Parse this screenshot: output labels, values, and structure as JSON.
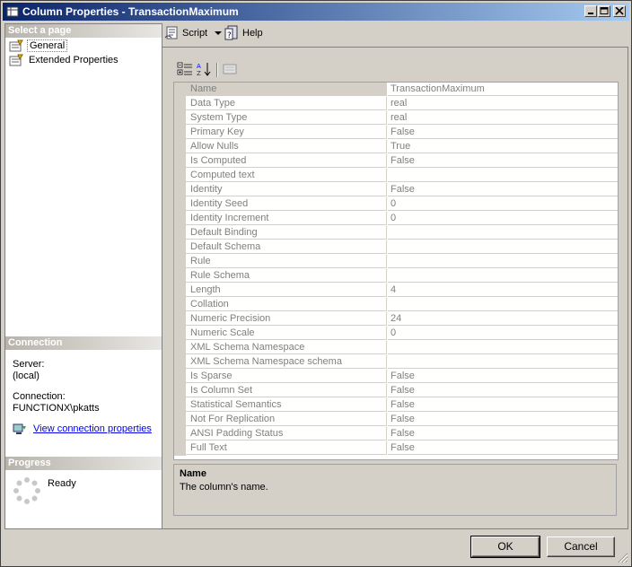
{
  "window": {
    "title": "Column Properties - TransactionMaximum"
  },
  "left_pane": {
    "select_page_header": "Select a page",
    "pages": [
      {
        "label": "General",
        "selected": true
      },
      {
        "label": "Extended Properties",
        "selected": false
      }
    ],
    "connection_header": "Connection",
    "server_label": "Server:",
    "server_value": "(local)",
    "connection_label": "Connection:",
    "connection_value": "FUNCTIONX\\pkatts",
    "view_connection_link": "View connection properties",
    "progress_header": "Progress",
    "progress_status": "Ready"
  },
  "toolbar": {
    "script_label": "Script",
    "help_label": "Help"
  },
  "properties": [
    {
      "name": "Name",
      "value": "TransactionMaximum"
    },
    {
      "name": "Data Type",
      "value": "real"
    },
    {
      "name": "System Type",
      "value": "real"
    },
    {
      "name": "Primary Key",
      "value": "False"
    },
    {
      "name": "Allow Nulls",
      "value": "True"
    },
    {
      "name": "Is Computed",
      "value": "False"
    },
    {
      "name": "Computed text",
      "value": ""
    },
    {
      "name": "Identity",
      "value": "False"
    },
    {
      "name": "Identity Seed",
      "value": "0"
    },
    {
      "name": "Identity Increment",
      "value": "0"
    },
    {
      "name": "Default Binding",
      "value": ""
    },
    {
      "name": "Default Schema",
      "value": ""
    },
    {
      "name": "Rule",
      "value": ""
    },
    {
      "name": "Rule Schema",
      "value": ""
    },
    {
      "name": "Length",
      "value": "4"
    },
    {
      "name": "Collation",
      "value": ""
    },
    {
      "name": "Numeric Precision",
      "value": "24"
    },
    {
      "name": "Numeric Scale",
      "value": "0"
    },
    {
      "name": "XML Schema Namespace",
      "value": ""
    },
    {
      "name": "XML Schema Namespace schema",
      "value": ""
    },
    {
      "name": "Is Sparse",
      "value": "False"
    },
    {
      "name": "Is Column Set",
      "value": "False"
    },
    {
      "name": "Statistical Semantics",
      "value": "False"
    },
    {
      "name": "Not For Replication",
      "value": "False"
    },
    {
      "name": "ANSI Padding Status",
      "value": "False"
    },
    {
      "name": "Full Text",
      "value": "False"
    }
  ],
  "description": {
    "title": "Name",
    "text": "The column's name."
  },
  "buttons": {
    "ok": "OK",
    "cancel": "Cancel"
  }
}
